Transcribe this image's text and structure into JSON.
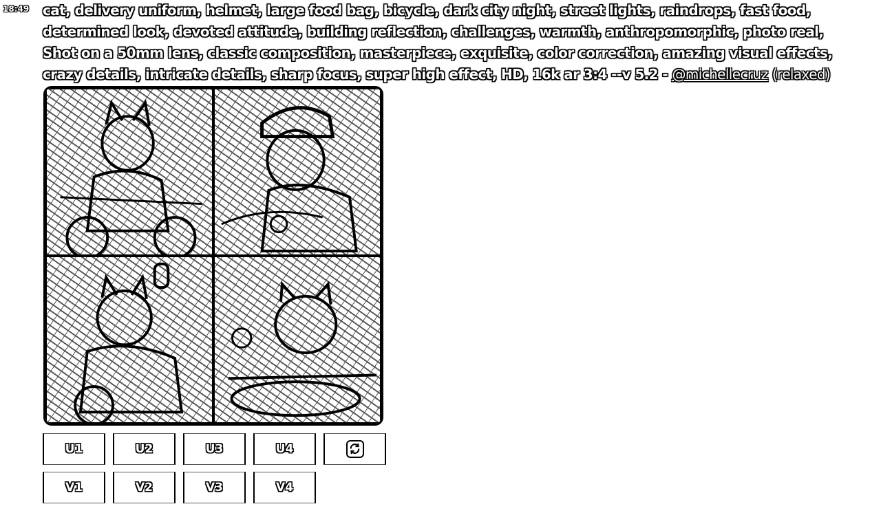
{
  "message": {
    "timestamp": "18:49",
    "prompt_text": "cat, delivery uniform, helmet, large food bag, bicycle, dark city night, street lights, raindrops, fast food, determined look, devoted attitude, building reflection, challenges, warmth, anthropomorphic, photo real, Shot on a 50mm lens, classic composition, masterpiece, exquisite, color correction, amazing visual effects, crazy details, intricate details, sharp focus, super high effect, HD, 16k ar 3:4 --v 5.2 -",
    "mention": "@michellecruz",
    "mode": "(relaxed)"
  },
  "image_grid": {
    "tiles": [
      {
        "id": "image-1"
      },
      {
        "id": "image-2"
      },
      {
        "id": "image-3"
      },
      {
        "id": "image-4"
      }
    ]
  },
  "buttons": {
    "upscale": [
      "U1",
      "U2",
      "U3",
      "U4"
    ],
    "variation": [
      "V1",
      "V2",
      "V3",
      "V4"
    ],
    "reroll_icon": "reroll-icon"
  }
}
